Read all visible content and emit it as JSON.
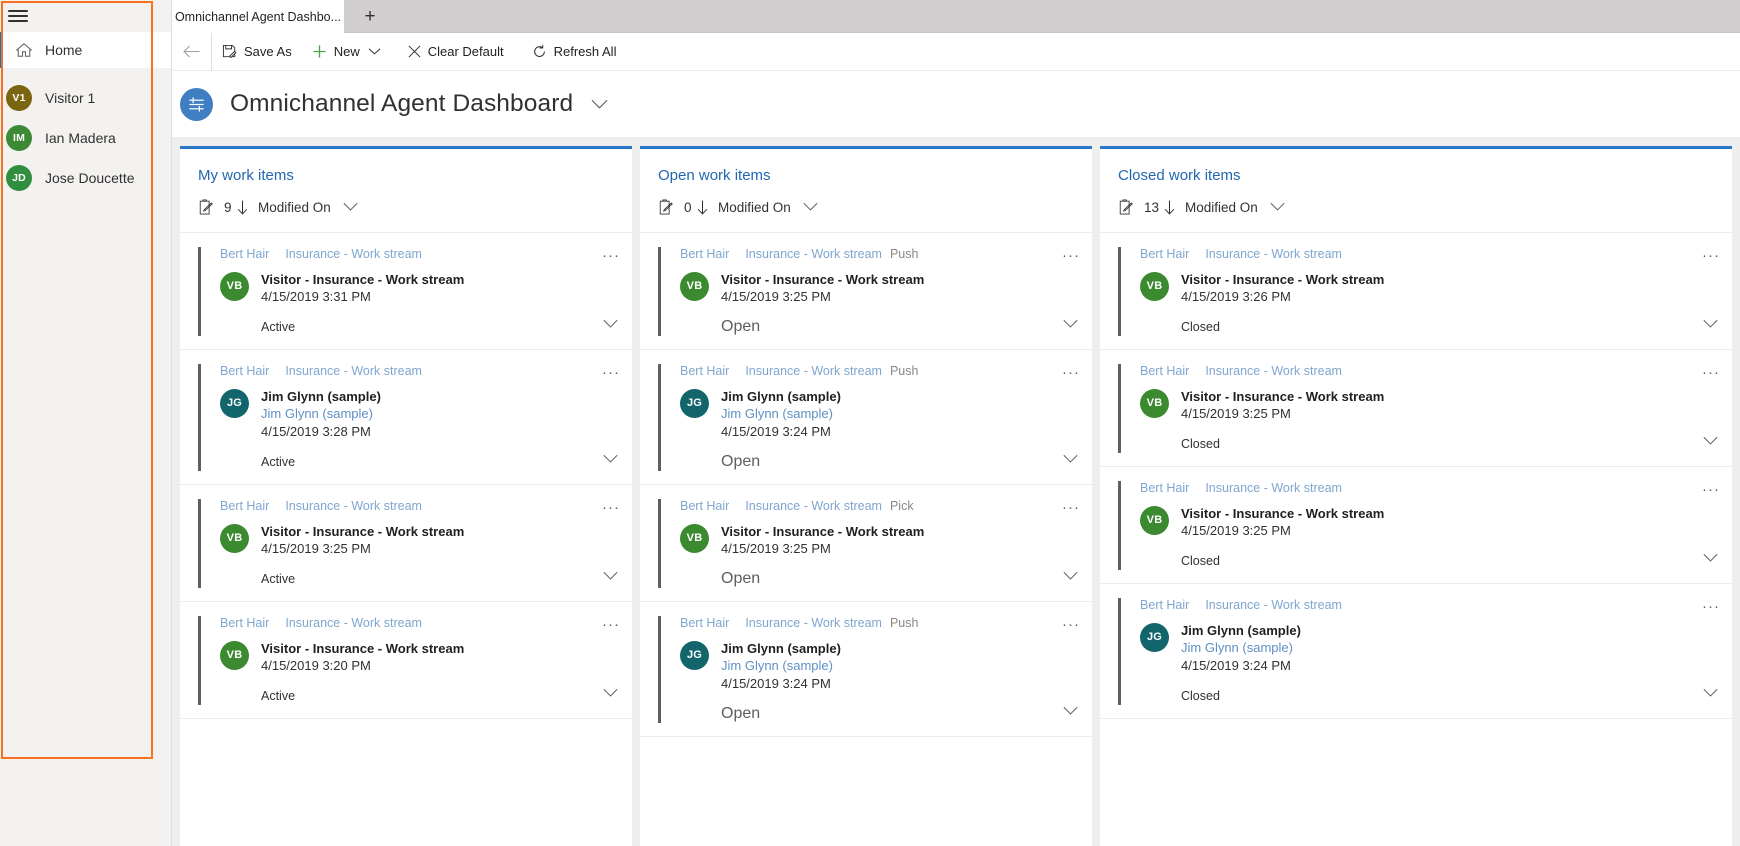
{
  "sidebar": {
    "hamburger_icon": "hamburger-icon",
    "home": {
      "label": "Home",
      "icon": "home-icon"
    },
    "items": [
      {
        "initials": "V1",
        "name": "Visitor 1",
        "color": "#7a6510"
      },
      {
        "initials": "IM",
        "name": "Ian Madera",
        "color": "#3c8a35"
      },
      {
        "initials": "JD",
        "name": "Jose Doucette",
        "color": "#2f8f3e"
      }
    ]
  },
  "tabs": {
    "active": "Omnichannel Agent Dashbo...",
    "new_tab_glyph": "+"
  },
  "commandbar": {
    "back_glyph": "←",
    "save_as": "Save As",
    "new": "New",
    "new_caret": "⌄",
    "clear_default": "Clear Default",
    "clear_default_glyph": "✕",
    "refresh_all": "Refresh All"
  },
  "header": {
    "title": "Omnichannel Agent Dashboard",
    "icon": "dashboard-icon",
    "caret": "⌄"
  },
  "colors": {
    "accent_top": "#2a76c8",
    "link": "#2267b0",
    "card_bar": "#5f5f5f",
    "focus_outline": "#f7711e"
  },
  "columns": [
    {
      "title": "My work items",
      "count": "9",
      "sort_label": "Modified On",
      "status_style": "small",
      "cards": [
        {
          "owner": "Bert Hair",
          "stream": "Insurance - Work stream",
          "mode": "",
          "initials": "VB",
          "avatar_color": "#3b8a30",
          "title": "Visitor - Insurance - Work stream",
          "subtitle": "",
          "date": "4/15/2019 3:31 PM",
          "status": "Active"
        },
        {
          "owner": "Bert Hair",
          "stream": "Insurance - Work stream",
          "mode": "",
          "initials": "JG",
          "avatar_color": "#11656b",
          "title": "Jim Glynn (sample)",
          "subtitle": "Jim Glynn (sample)",
          "date": "4/15/2019 3:28 PM",
          "status": "Active"
        },
        {
          "owner": "Bert Hair",
          "stream": "Insurance - Work stream",
          "mode": "",
          "initials": "VB",
          "avatar_color": "#3b8a30",
          "title": "Visitor - Insurance - Work stream",
          "subtitle": "",
          "date": "4/15/2019 3:25 PM",
          "status": "Active"
        },
        {
          "owner": "Bert Hair",
          "stream": "Insurance - Work stream",
          "mode": "",
          "initials": "VB",
          "avatar_color": "#3b8a30",
          "title": "Visitor - Insurance - Work stream",
          "subtitle": "",
          "date": "4/15/2019 3:20 PM",
          "status": "Active"
        }
      ]
    },
    {
      "title": "Open work items",
      "count": "0",
      "sort_label": "Modified On",
      "status_style": "large",
      "cards": [
        {
          "owner": "Bert Hair",
          "stream": "Insurance - Work stream",
          "mode": "Push",
          "initials": "VB",
          "avatar_color": "#3b8a30",
          "title": "Visitor - Insurance - Work stream",
          "subtitle": "",
          "date": "4/15/2019 3:25 PM",
          "status": "Open"
        },
        {
          "owner": "Bert Hair",
          "stream": "Insurance - Work stream",
          "mode": "Push",
          "initials": "JG",
          "avatar_color": "#11656b",
          "title": "Jim Glynn (sample)",
          "subtitle": "Jim Glynn (sample)",
          "date": "4/15/2019 3:24 PM",
          "status": "Open"
        },
        {
          "owner": "Bert Hair",
          "stream": "Insurance - Work stream",
          "mode": "Pick",
          "initials": "VB",
          "avatar_color": "#3b8a30",
          "title": "Visitor - Insurance - Work stream",
          "subtitle": "",
          "date": "4/15/2019 3:25 PM",
          "status": "Open"
        },
        {
          "owner": "Bert Hair",
          "stream": "Insurance - Work stream",
          "mode": "Push",
          "initials": "JG",
          "avatar_color": "#11656b",
          "title": "Jim Glynn (sample)",
          "subtitle": "Jim Glynn (sample)",
          "date": "4/15/2019 3:24 PM",
          "status": "Open"
        }
      ]
    },
    {
      "title": "Closed work items",
      "count": "13",
      "sort_label": "Modified On",
      "status_style": "small",
      "cards": [
        {
          "owner": "Bert Hair",
          "stream": "Insurance - Work stream",
          "mode": "",
          "initials": "VB",
          "avatar_color": "#3b8a30",
          "title": "Visitor - Insurance - Work stream",
          "subtitle": "",
          "date": "4/15/2019 3:26 PM",
          "status": "Closed"
        },
        {
          "owner": "Bert Hair",
          "stream": "Insurance - Work stream",
          "mode": "",
          "initials": "VB",
          "avatar_color": "#3b8a30",
          "title": "Visitor - Insurance - Work stream",
          "subtitle": "",
          "date": "4/15/2019 3:25 PM",
          "status": "Closed"
        },
        {
          "owner": "Bert Hair",
          "stream": "Insurance - Work stream",
          "mode": "",
          "initials": "VB",
          "avatar_color": "#3b8a30",
          "title": "Visitor - Insurance - Work stream",
          "subtitle": "",
          "date": "4/15/2019 3:25 PM",
          "status": "Closed"
        },
        {
          "owner": "Bert Hair",
          "stream": "Insurance - Work stream",
          "mode": "",
          "initials": "JG",
          "avatar_color": "#11656b",
          "title": "Jim Glynn (sample)",
          "subtitle": "Jim Glynn (sample)",
          "date": "4/15/2019 3:24 PM",
          "status": "Closed"
        }
      ]
    }
  ]
}
